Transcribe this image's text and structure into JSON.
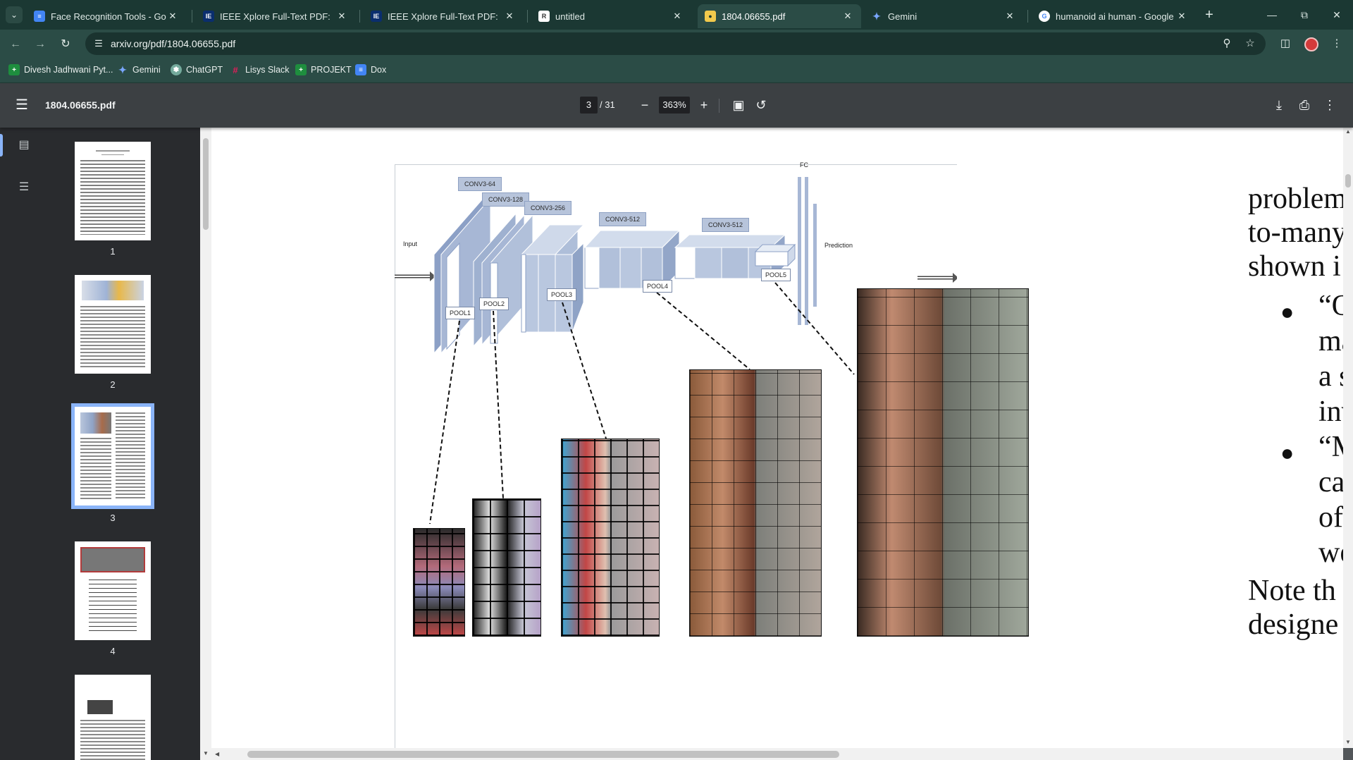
{
  "browser": {
    "tabs": [
      {
        "title": "Face Recognition Tools - Googl",
        "favicon": "docs-icon",
        "active": false
      },
      {
        "title": "IEEE Xplore Full-Text PDF:",
        "favicon": "ieee-icon",
        "active": false
      },
      {
        "title": "IEEE Xplore Full-Text PDF:",
        "favicon": "ieee-icon",
        "active": false
      },
      {
        "title": "untitled",
        "favicon": "r-icon",
        "active": false
      },
      {
        "title": "1804.06655.pdf",
        "favicon": "pdf-icon",
        "active": true
      },
      {
        "title": "Gemini",
        "favicon": "gemini-icon",
        "active": false
      },
      {
        "title": "humanoid ai human - Google S",
        "favicon": "google-icon",
        "active": false
      }
    ],
    "url": "arxiv.org/pdf/1804.06655.pdf",
    "bookmarks": [
      {
        "label": "Divesh Jadhwani Pyt...",
        "icon": "sheets-icon",
        "color": "#1e8e3e"
      },
      {
        "label": "Gemini",
        "icon": "gemini-icon",
        "color": "#4c8bf5"
      },
      {
        "label": "ChatGPT",
        "icon": "chatgpt-icon",
        "color": "#74aa9c"
      },
      {
        "label": "Lisys Slack",
        "icon": "slack-icon",
        "color": "#611f69"
      },
      {
        "label": "PROJEKT",
        "icon": "sheets-icon",
        "color": "#1e8e3e"
      },
      {
        "label": "Dox",
        "icon": "docs-icon",
        "color": "#4285f4"
      }
    ]
  },
  "pdf": {
    "filename": "1804.06655.pdf",
    "current_page": "3",
    "total_pages": "/ 31",
    "zoom": "363%",
    "thumbnails": [
      {
        "label": "1"
      },
      {
        "label": "2"
      },
      {
        "label": "3"
      },
      {
        "label": "4"
      }
    ]
  },
  "figure": {
    "input_label": "Input",
    "prediction_label": "Prediction",
    "fc_label": "FC",
    "conv_labels": [
      "CONV3-64",
      "CONV3-128",
      "CONV3-256",
      "CONV3-512",
      "CONV3-512"
    ],
    "pool_labels": [
      "POOL1",
      "POOL2",
      "POOL3",
      "POOL4",
      "POOL5"
    ]
  },
  "text_column": {
    "lines": [
      "problem",
      "to-many",
      "shown i"
    ],
    "bullet1": [
      "“O",
      "ma",
      "a  s",
      "inv"
    ],
    "bullet2": [
      "“M",
      "ca",
      "of",
      "we"
    ],
    "trailing": [
      "Note  th",
      "designe"
    ]
  }
}
